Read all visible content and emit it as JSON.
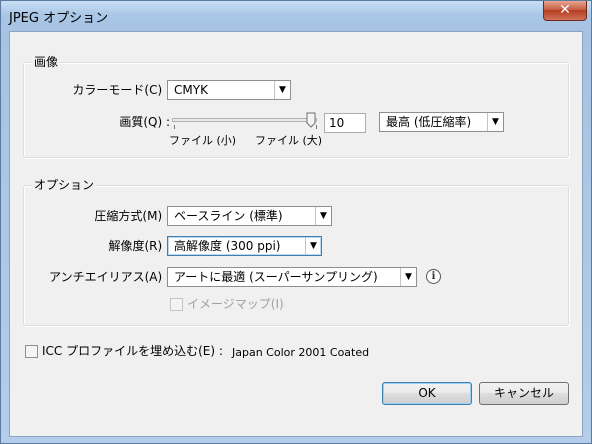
{
  "window": {
    "title": "JPEG オプション",
    "close_glyph": "✕"
  },
  "image_group": {
    "legend": "画像",
    "color_mode": {
      "label": "カラーモード(C) :",
      "value": "CMYK"
    },
    "quality": {
      "label": "画質(Q) :",
      "value": "10",
      "level": 10,
      "min": 0,
      "max": 10,
      "small_file_label": "ファイル (小)",
      "large_file_label": "ファイル (大)",
      "preset": "最高 (低圧縮率)"
    }
  },
  "options_group": {
    "legend": "オプション",
    "compression": {
      "label": "圧縮方式(M) :",
      "value": "ベースライン (標準)"
    },
    "resolution": {
      "label": "解像度(R) :",
      "value": "高解像度 (300 ppi)"
    },
    "antialias": {
      "label": "アンチエイリアス(A) :",
      "value": "アートに最適 (スーパーサンプリング)",
      "info_glyph": "i"
    },
    "imagemap": {
      "label": "イメージマップ(I)",
      "checked": false,
      "enabled": false
    }
  },
  "icc": {
    "label": "ICC プロファイルを埋め込む(E) :",
    "profile": "Japan Color 2001 Coated",
    "checked": false
  },
  "buttons": {
    "ok": "OK",
    "cancel": "キャンセル"
  },
  "colors": {
    "title_bar": "#a9c6e6",
    "dialog_bg": "#f0f0f0",
    "focus_border": "#3c7fb1",
    "close_button": "#c75e45"
  }
}
